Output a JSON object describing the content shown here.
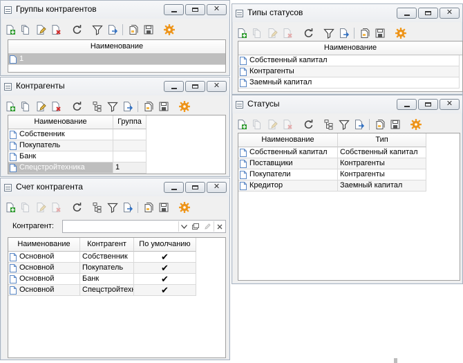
{
  "windows": {
    "groups": {
      "title": "Группы контрагентов",
      "columns": [
        "Наименование"
      ],
      "rows": [
        [
          "1"
        ]
      ]
    },
    "status_types": {
      "title": "Типы статусов",
      "columns": [
        "Наименование"
      ],
      "rows": [
        [
          "Собственный капитал"
        ],
        [
          "Контрагенты"
        ],
        [
          "Заемный капитал"
        ]
      ]
    },
    "contractors": {
      "title": "Контрагенты",
      "columns": [
        "Наименование",
        "Группа"
      ],
      "rows": [
        [
          "Собственник",
          ""
        ],
        [
          "Покупатель",
          ""
        ],
        [
          "Банк",
          ""
        ],
        [
          "Спецстройтехника",
          "1"
        ]
      ]
    },
    "statuses": {
      "title": "Статусы",
      "columns": [
        "Наименование",
        "Тип"
      ],
      "rows": [
        [
          "Собственный капитал",
          "Собственный капитал"
        ],
        [
          "Поставщики",
          "Контрагенты"
        ],
        [
          "Покупатели",
          "Контрагенты"
        ],
        [
          "Кредитор",
          "Заемный капитал"
        ]
      ]
    },
    "account": {
      "title": "Счет контрагента",
      "filter_label": "Контрагент:",
      "filter_value": "",
      "columns": [
        "Наименование",
        "Контрагент",
        "По умолчанию"
      ],
      "rows": [
        [
          "Основной",
          "Собственник",
          "✔"
        ],
        [
          "Основной",
          "Покупатель",
          "✔"
        ],
        [
          "Основной",
          "Банк",
          "✔"
        ],
        [
          "Основной",
          "Спецстройтехн",
          "✔"
        ]
      ]
    }
  },
  "colors": {
    "accent_orange": "#f39a1c",
    "add_green": "#2e9a2e",
    "delete_red": "#d22b2b",
    "selection_gray": "#bebebe"
  },
  "icons": [
    "add-icon",
    "copy-icon",
    "edit-icon",
    "delete-icon",
    "refresh-icon",
    "tree-icon",
    "filter-icon",
    "export-icon",
    "page-icon",
    "save-icon",
    "settings-icon"
  ]
}
